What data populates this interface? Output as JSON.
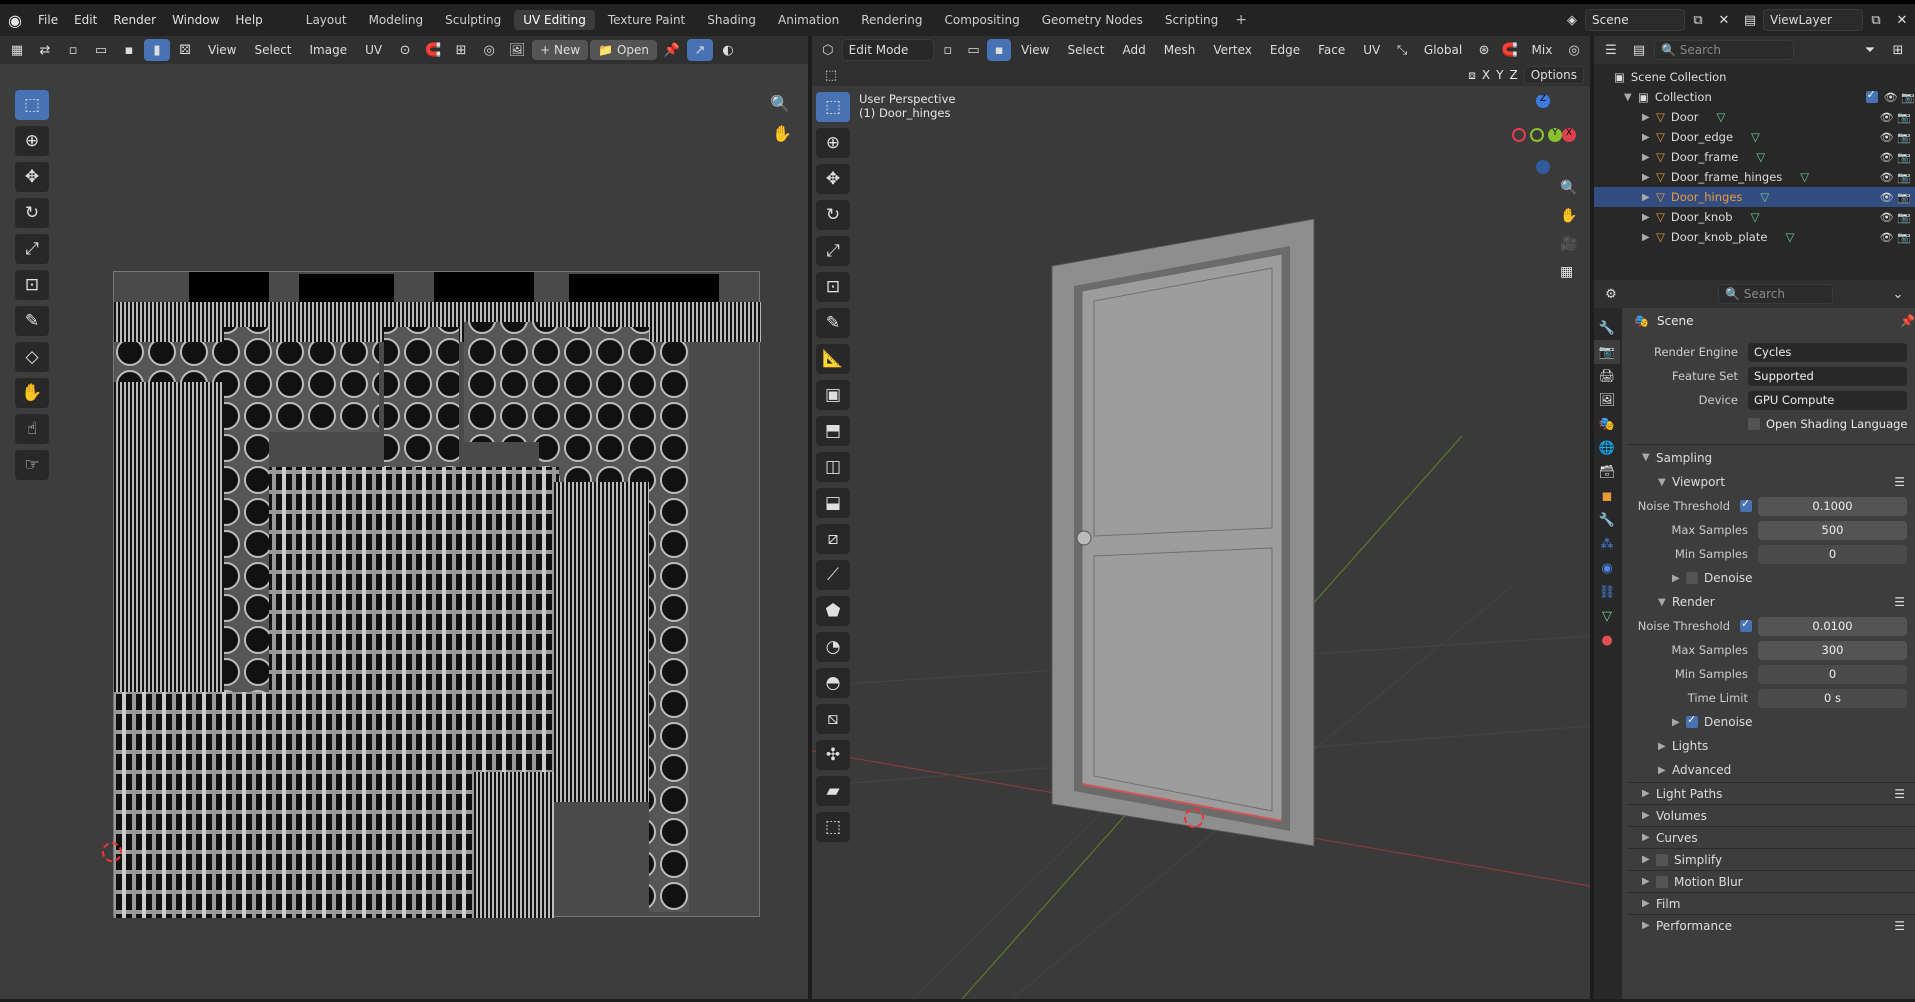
{
  "menu": [
    "File",
    "Edit",
    "Render",
    "Window",
    "Help"
  ],
  "workspaces": [
    {
      "label": "Layout",
      "active": false
    },
    {
      "label": "Modeling",
      "active": false
    },
    {
      "label": "Sculpting",
      "active": false
    },
    {
      "label": "UV Editing",
      "active": true
    },
    {
      "label": "Texture Paint",
      "active": false
    },
    {
      "label": "Shading",
      "active": false
    },
    {
      "label": "Animation",
      "active": false
    },
    {
      "label": "Rendering",
      "active": false
    },
    {
      "label": "Compositing",
      "active": false
    },
    {
      "label": "Geometry Nodes",
      "active": false
    },
    {
      "label": "Scripting",
      "active": false
    }
  ],
  "scene_field": "Scene",
  "viewlayer_field": "ViewLayer",
  "uv_header": {
    "menus": [
      "View",
      "Select",
      "Image",
      "UV"
    ],
    "new_label": "New",
    "open_label": "Open"
  },
  "viewport_header": {
    "mode": "Edit Mode",
    "menus": [
      "View",
      "Select",
      "Add",
      "Mesh",
      "Vertex",
      "Edge",
      "Face",
      "UV"
    ],
    "transform": "Global",
    "proportional": "Mix",
    "options": "Options"
  },
  "viewport": {
    "perspective": "User Perspective",
    "object": "(1) Door_hinges",
    "axis_x": "X",
    "axis_y": "Y",
    "axis_z": "Z"
  },
  "outliner": {
    "search_placeholder": "Search",
    "root": "Scene Collection",
    "collection": "Collection",
    "items": [
      {
        "name": "Door",
        "selected": false
      },
      {
        "name": "Door_edge",
        "selected": false
      },
      {
        "name": "Door_frame",
        "selected": false
      },
      {
        "name": "Door_frame_hinges",
        "selected": false
      },
      {
        "name": "Door_hinges",
        "selected": true
      },
      {
        "name": "Door_knob",
        "selected": false
      },
      {
        "name": "Door_knob_plate",
        "selected": false
      }
    ]
  },
  "properties": {
    "search_placeholder": "Search",
    "context": "Scene",
    "render_engine_label": "Render Engine",
    "render_engine": "Cycles",
    "feature_set_label": "Feature Set",
    "feature_set": "Supported",
    "device_label": "Device",
    "device": "GPU Compute",
    "osl_label": "Open Shading Language",
    "sampling": "Sampling",
    "viewport": "Viewport",
    "render": "Render",
    "noise_threshold_label": "Noise Threshold",
    "viewport_noise": "0.1000",
    "max_samples_label": "Max Samples",
    "viewport_max": "500",
    "min_samples_label": "Min Samples",
    "viewport_min": "0",
    "denoise_label": "Denoise",
    "render_noise": "0.0100",
    "render_max": "300",
    "render_min": "0",
    "time_limit_label": "Time Limit",
    "time_limit": "0 s",
    "lights": "Lights",
    "advanced": "Advanced",
    "sections": [
      "Light Paths",
      "Volumes",
      "Curves",
      "Simplify",
      "Motion Blur",
      "Film",
      "Performance"
    ]
  }
}
